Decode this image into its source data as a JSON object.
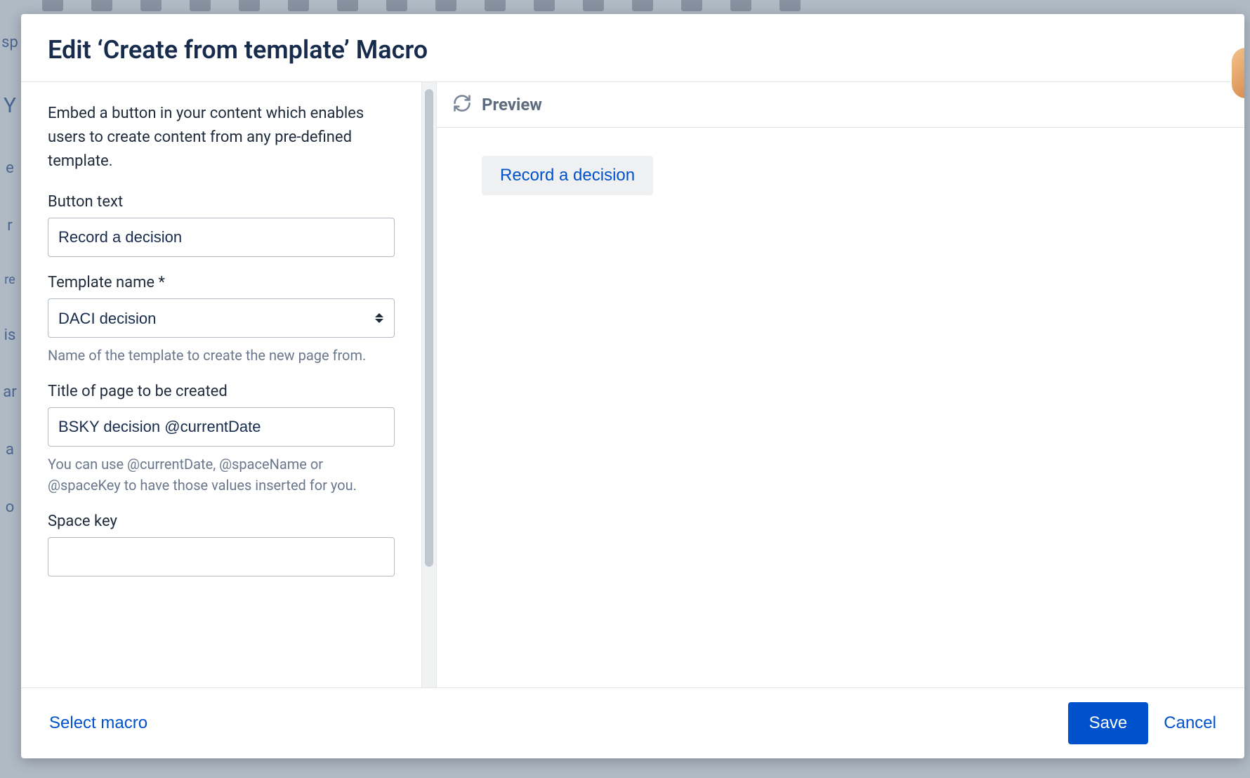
{
  "dialog": {
    "title": "Edit ‘Create from template’ Macro"
  },
  "config": {
    "description": "Embed a button in your content which enables users to create content from any pre-defined template.",
    "fields": {
      "button_text": {
        "label": "Button text",
        "value": "Record a decision"
      },
      "template_name": {
        "label": "Template name *",
        "value": "DACI decision",
        "help": "Name of the template to create the new page from."
      },
      "page_title": {
        "label": "Title of page to be created",
        "value": "BSKY decision @currentDate",
        "help": "You can use @currentDate, @spaceName or @spaceKey to have those values inserted for you."
      },
      "space_key": {
        "label": "Space key",
        "value": ""
      }
    }
  },
  "preview": {
    "header_label": "Preview",
    "button_label": "Record a decision"
  },
  "footer": {
    "select_macro": "Select macro",
    "save": "Save",
    "cancel": "Cancel"
  }
}
